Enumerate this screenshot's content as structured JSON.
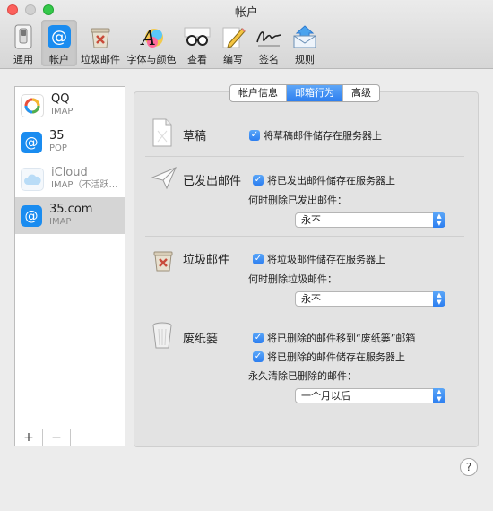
{
  "window": {
    "title": "帐户"
  },
  "toolbar": {
    "items": [
      {
        "label": "通用",
        "icon": "general-switch-icon"
      },
      {
        "label": "帐户",
        "icon": "at-sign-icon",
        "selected": true
      },
      {
        "label": "垃圾邮件",
        "icon": "junk-trash-icon"
      },
      {
        "label": "字体与颜色",
        "icon": "fonts-colors-icon"
      },
      {
        "label": "查看",
        "icon": "glasses-icon"
      },
      {
        "label": "编写",
        "icon": "pencil-icon"
      },
      {
        "label": "签名",
        "icon": "signature-icon"
      },
      {
        "label": "规则",
        "icon": "rules-envelope-icon"
      }
    ]
  },
  "accounts": [
    {
      "name": "QQ",
      "type": "IMAP",
      "icon": "qq-account-icon"
    },
    {
      "name": "35",
      "type": "POP",
      "icon": "at-account-icon"
    },
    {
      "name": "iCloud",
      "type": "IMAP（不活跃…",
      "icon": "icloud-icon",
      "dim": true
    },
    {
      "name": "35.com",
      "type": "IMAP",
      "icon": "at-account-icon",
      "selected": true
    }
  ],
  "list_footer": {
    "add": "+",
    "remove": "−"
  },
  "tabs": {
    "info": "帐户信息",
    "behavior": "邮箱行为",
    "advanced": "高级",
    "active": "behavior"
  },
  "drafts": {
    "title": "草稿",
    "store_label": "将草稿邮件储存在服务器上"
  },
  "sent": {
    "title": "已发出邮件",
    "store_label": "将已发出邮件储存在服务器上",
    "delete_label": "何时删除已发出邮件：",
    "delete_value": "永不"
  },
  "junk": {
    "title": "垃圾邮件",
    "store_label": "将垃圾邮件储存在服务器上",
    "delete_label": "何时删除垃圾邮件：",
    "delete_value": "永不"
  },
  "trash": {
    "title": "废纸篓",
    "move_label": "将已删除的邮件移到“废纸篓”邮箱",
    "store_label": "将已删除的邮件储存在服务器上",
    "erase_label": "永久清除已删除的邮件：",
    "erase_value": "一个月以后"
  },
  "help": "?",
  "colors": {
    "accent": "#2d7ff0",
    "selected_row": "#d5d5d5"
  }
}
